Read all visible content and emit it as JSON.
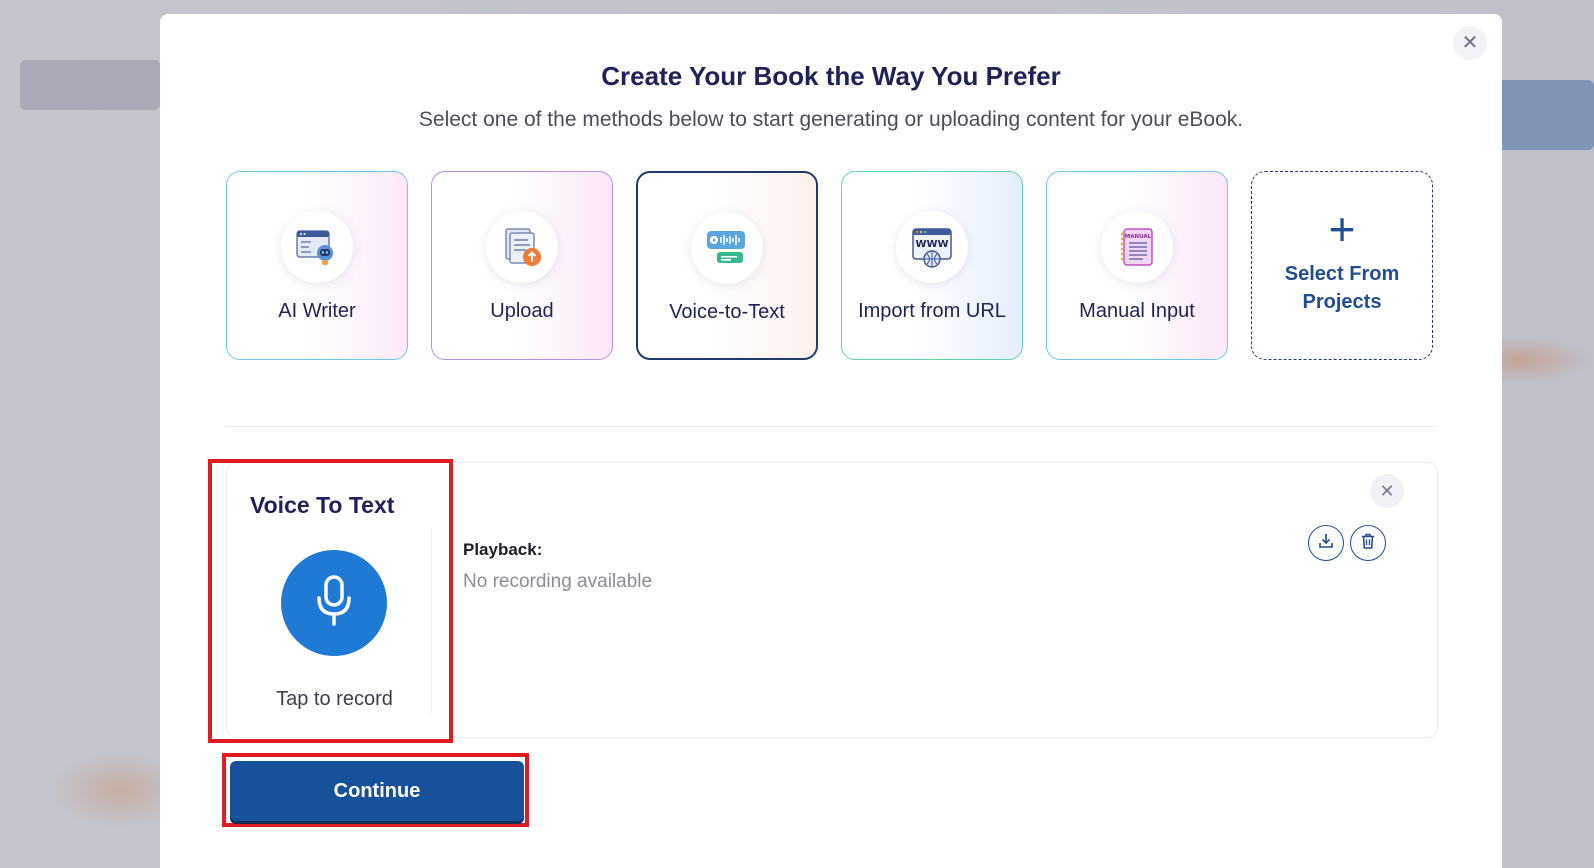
{
  "modal": {
    "title": "Create Your Book the Way You Prefer",
    "subtitle": "Select one of the methods below to start generating or uploading content for your eBook.",
    "close_icon": "close-icon"
  },
  "methods": [
    {
      "label": "AI Writer",
      "icon": "ai-robot-icon"
    },
    {
      "label": "Upload",
      "icon": "upload-document-icon"
    },
    {
      "label": "Voice-to-Text",
      "icon": "voice-chat-icon",
      "selected": true
    },
    {
      "label": "Import from URL",
      "icon": "www-globe-icon"
    },
    {
      "label": "Manual Input",
      "icon": "manual-notebook-icon"
    },
    {
      "label": "Select From Projects",
      "icon": "plus-icon"
    }
  ],
  "voice": {
    "title": "Voice To Text",
    "tap_label": "Tap to record",
    "mic_icon": "microphone-icon"
  },
  "playback": {
    "label": "Playback:",
    "status": "No recording available"
  },
  "manual_icon_text": "MANUAL",
  "url_icon_text": "WWW",
  "continue_label": "Continue",
  "colors": {
    "primary": "#17519A",
    "mic": "#1F7AD6",
    "title": "#1F2258",
    "highlight": "#E01B24"
  }
}
